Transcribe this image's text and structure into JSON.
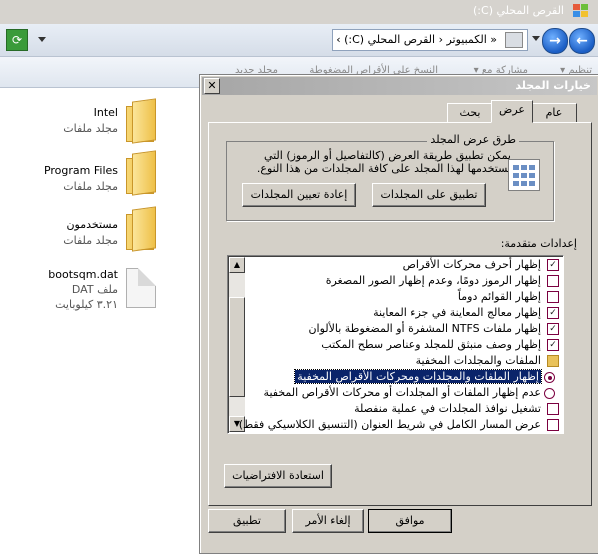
{
  "window": {
    "title": "القرص المحلي (C:)"
  },
  "address": {
    "path": "« الكمبيوتر ‹ القرص المحلي (C:) ›"
  },
  "cmdbar_ghost": [
    "تنظيم ▾",
    "مشاركة مع ▾",
    "النسخ على الأقراص المضغوطة",
    "مجلد جديد"
  ],
  "files": [
    {
      "name": "Intel",
      "type": "مجلد ملفات",
      "icon": "folder-icon"
    },
    {
      "name": "Program Files",
      "type": "مجلد ملفات",
      "icon": "folder-icon"
    },
    {
      "name": "مستخدمون",
      "type": "مجلد ملفات",
      "icon": "folder-icon"
    },
    {
      "name": "bootsqm.dat",
      "type": "ملف DAT",
      "size": "٣.٢١ كيلوبايت",
      "icon": "document-icon"
    }
  ],
  "dialog": {
    "title": "خيارات المجلد",
    "tabs": [
      "عام",
      "عرض",
      "بحث"
    ],
    "active_tab": "عرض",
    "folder_views": {
      "legend": "طرق عرض المجلد",
      "description": "يمكن تطبيق طريقة العرض (كالتفاصيل أو الرموز) التي تستخدمها لهذا المجلد على كافة المجلدات من هذا النوع.",
      "apply_button": "تطبيق على المجلدات",
      "reset_button": "إعادة تعيين المجلدات"
    },
    "advanced_label": "إعدادات متقدمة:",
    "advanced_items": [
      {
        "kind": "checkbox",
        "checked": true,
        "label": "إظهار أحرف محركات الأقراص"
      },
      {
        "kind": "checkbox",
        "checked": false,
        "label": "إظهار الرموز دومًا، وعدم إظهار الصور المصغرة"
      },
      {
        "kind": "checkbox",
        "checked": false,
        "label": "إظهار القوائم دوماً"
      },
      {
        "kind": "checkbox",
        "checked": true,
        "label": "إظهار معالج المعاينة في جزء المعاينة"
      },
      {
        "kind": "checkbox",
        "checked": true,
        "label": "إظهار ملفات NTFS المشفرة أو المضغوطة بالألوان"
      },
      {
        "kind": "checkbox",
        "checked": true,
        "label": "إظهار وصف منبثق للمجلد وعناصر سطح المكتب"
      },
      {
        "kind": "folder",
        "label": "الملفات والمجلدات المخفية"
      },
      {
        "kind": "radio",
        "checked": true,
        "selected": true,
        "label": "إظهار الملفات والمجلدات ومحركات الأقراص المخفية"
      },
      {
        "kind": "radio",
        "checked": false,
        "label": "عدم إظهار الملفات أو المجلدات أو محركات الأقراص المخفية"
      },
      {
        "kind": "checkbox",
        "checked": false,
        "label": "تشغيل نوافذ المجلدات في عملية منفصلة"
      },
      {
        "kind": "checkbox",
        "checked": false,
        "label": "عرض المسار الكامل في شريط العنوان (التنسيق الكلاسيكي فقط)"
      }
    ],
    "restore_button": "استعادة الافتراضيات",
    "ok_button": "موافق",
    "cancel_button": "إلغاء الأمر",
    "apply_button": "تطبيق"
  }
}
